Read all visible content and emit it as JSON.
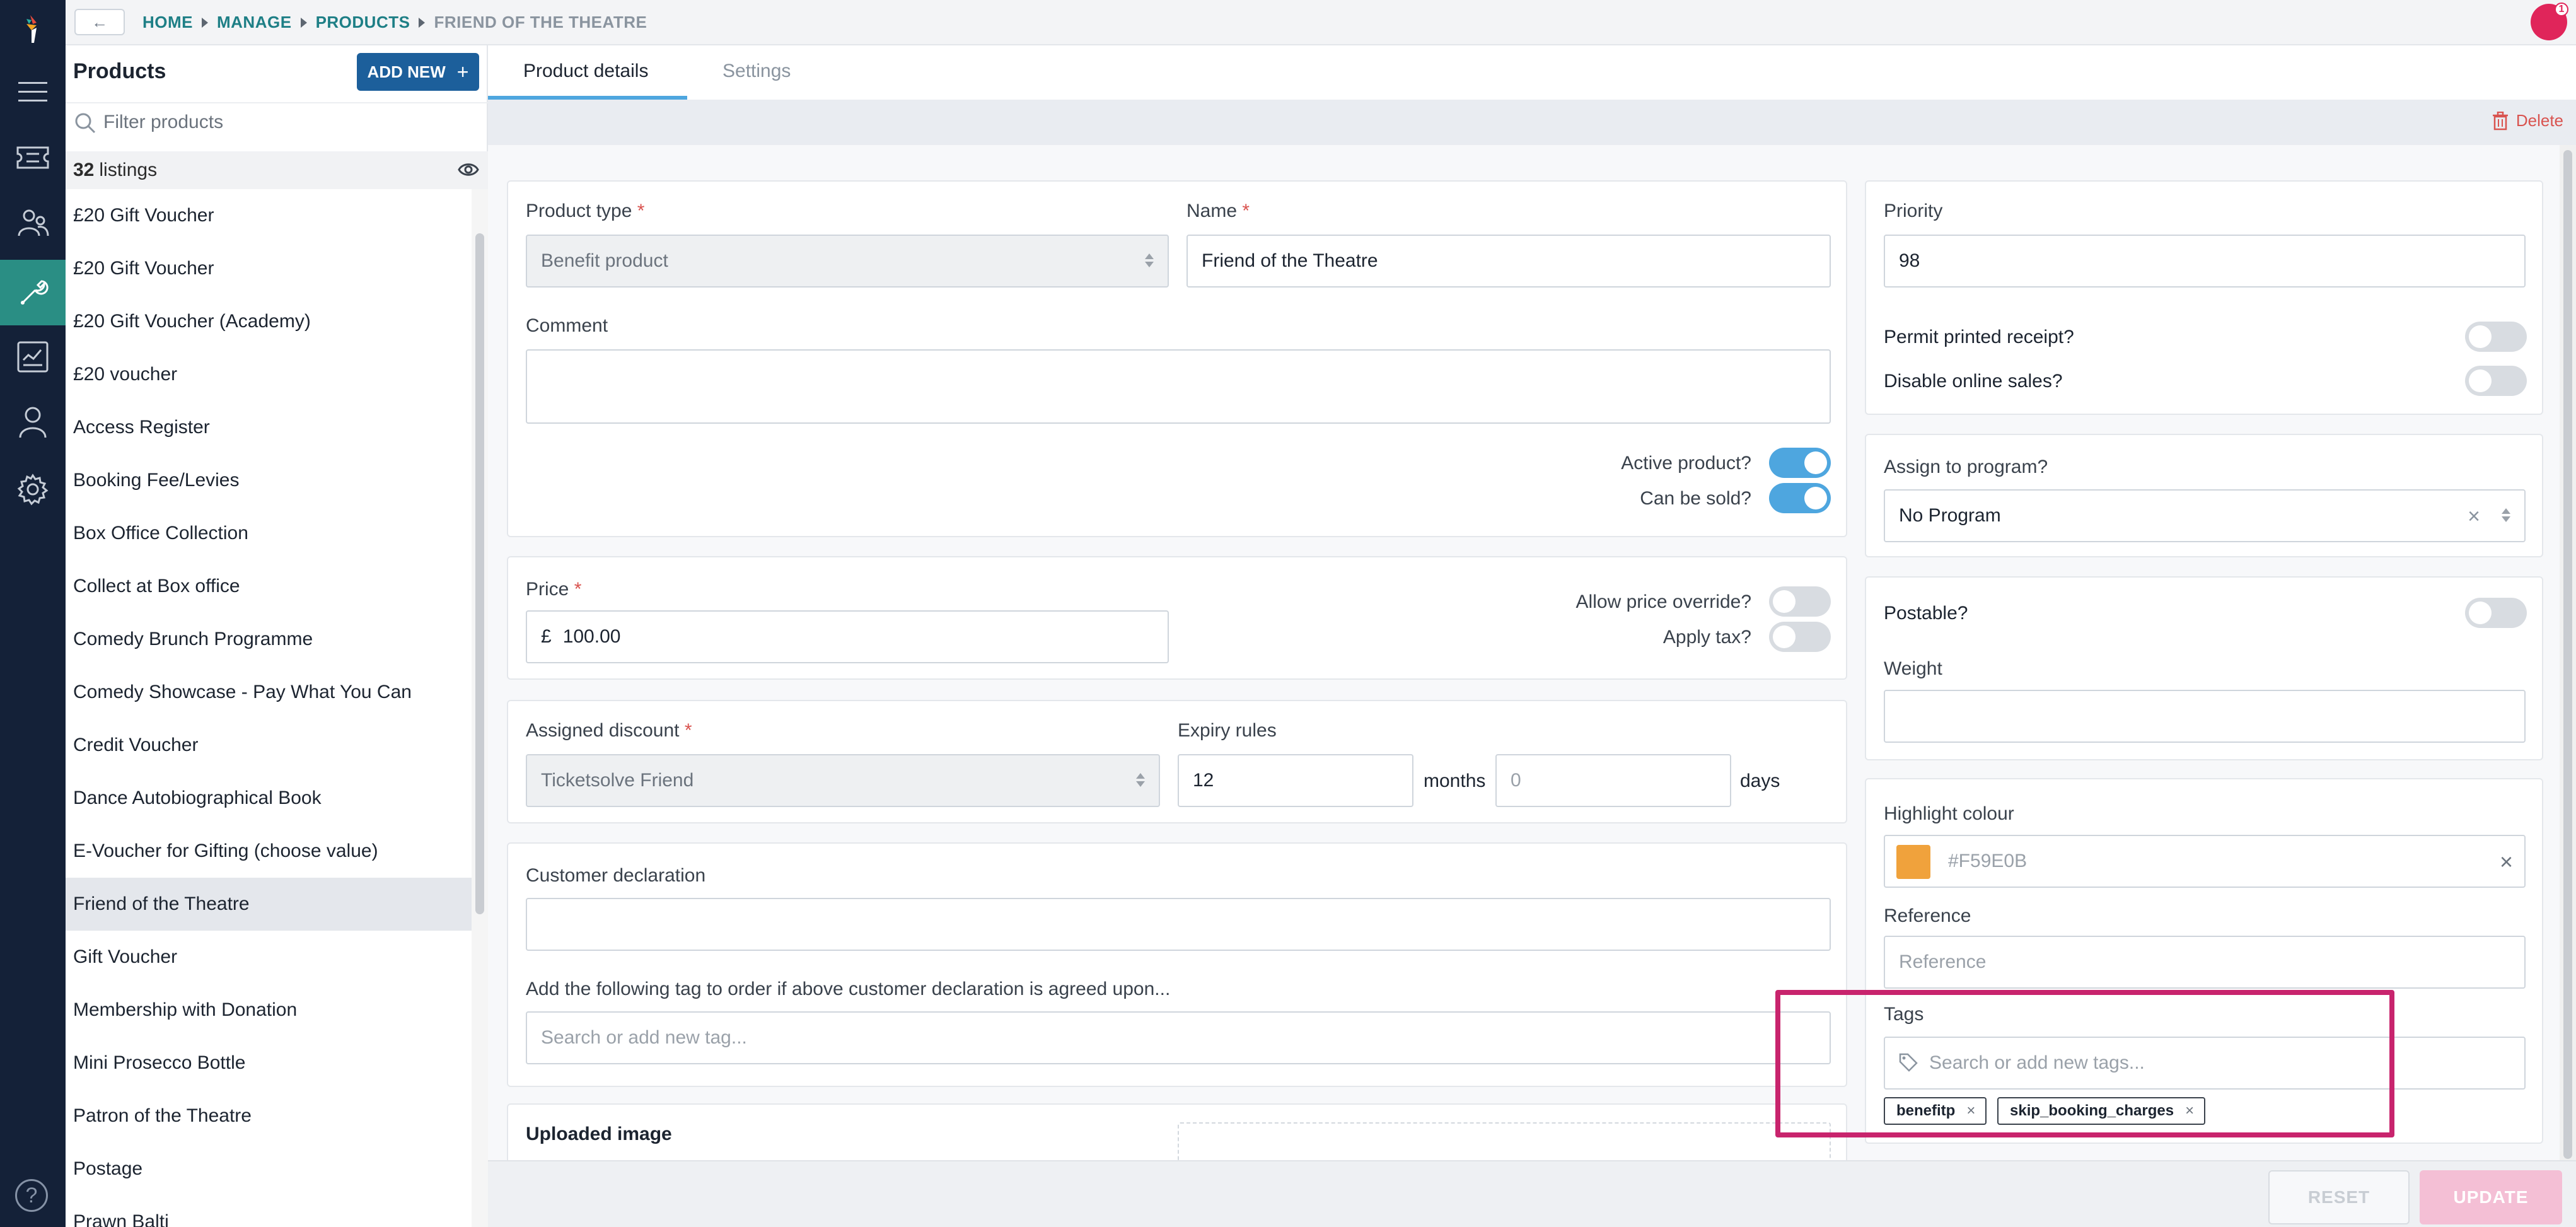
{
  "breadcrumb": {
    "back_label": "←",
    "items": [
      "HOME",
      "MANAGE",
      "PRODUCTS",
      "FRIEND OF THE THEATRE"
    ]
  },
  "user": {
    "notification_count": "1"
  },
  "product_list": {
    "title": "Products",
    "add_new_label": "ADD NEW",
    "add_new_icon": "+",
    "filter_placeholder": "Filter products",
    "listing_count": "32",
    "listing_suffix": "listings",
    "items": [
      "£20 Gift Voucher",
      "£20 Gift Voucher",
      "£20 Gift Voucher (Academy)",
      "£20 voucher",
      "Access Register",
      "Booking Fee/Levies",
      "Box Office Collection",
      "Collect at Box office",
      "Comedy Brunch Programme",
      "Comedy Showcase - Pay What You Can",
      "Credit Voucher",
      "Dance Autobiographical Book",
      "E-Voucher for Gifting (choose value)",
      "Friend of the Theatre",
      "Gift Voucher",
      "Membership with Donation",
      "Mini Prosecco Bottle",
      "Patron of the Theatre",
      "Postage",
      "Prawn Balti"
    ],
    "selected_index": 13
  },
  "tabs": {
    "details": "Product details",
    "settings": "Settings"
  },
  "delete_label": "Delete",
  "form": {
    "product_type_label": "Product type",
    "product_type_value": "Benefit product",
    "name_label": "Name",
    "name_value": "Friend of the Theatre",
    "comment_label": "Comment",
    "comment_value": "",
    "active_label": "Active product?",
    "active_on": true,
    "sold_label": "Can be sold?",
    "sold_on": true,
    "price_label": "Price",
    "price_currency": "£",
    "price_value": "100.00",
    "override_label": "Allow price override?",
    "override_on": false,
    "tax_label": "Apply tax?",
    "tax_on": false,
    "discount_label": "Assigned discount",
    "discount_value": "Ticketsolve Friend",
    "expiry_label": "Expiry rules",
    "expiry_months_value": "12",
    "expiry_months_unit": "months",
    "expiry_days_placeholder": "0",
    "expiry_days_unit": "days",
    "declaration_label": "Customer declaration",
    "declaration_value": "",
    "declaration_tag_label": "Add the following tag to order if above customer declaration is agreed upon...",
    "declaration_tag_placeholder": "Search or add new tag...",
    "uploaded_image_label": "Uploaded image",
    "required_mark": "*"
  },
  "side_form": {
    "priority_label": "Priority",
    "priority_value": "98",
    "receipt_label": "Permit printed receipt?",
    "receipt_on": false,
    "online_label": "Disable online sales?",
    "online_on": false,
    "program_label": "Assign to program?",
    "program_value": "No Program",
    "postable_label": "Postable?",
    "postable_on": false,
    "weight_label": "Weight",
    "weight_value": "",
    "highlight_label": "Highlight colour",
    "highlight_value": "#F59E0B",
    "highlight_swatch": "#F0A23C",
    "reference_label": "Reference",
    "reference_placeholder": "Reference",
    "tags_label": "Tags",
    "tags_placeholder": "Search or add new tags...",
    "tags": [
      "benefitp",
      "skip_booking_charges"
    ]
  },
  "footer": {
    "reset_label": "RESET",
    "update_label": "UPDATE"
  },
  "colors": {
    "rail": "#142138",
    "active_rail": "#2a8e84",
    "accent": "#4ea6df",
    "primary": "#1c5f9b",
    "highlight_annotation": "#c8246d"
  },
  "icons": {
    "rail": [
      "menu-icon",
      "tickets-icon",
      "users-icon",
      "tools-icon",
      "reports-icon",
      "person-icon",
      "settings-icon",
      "help-icon"
    ]
  }
}
